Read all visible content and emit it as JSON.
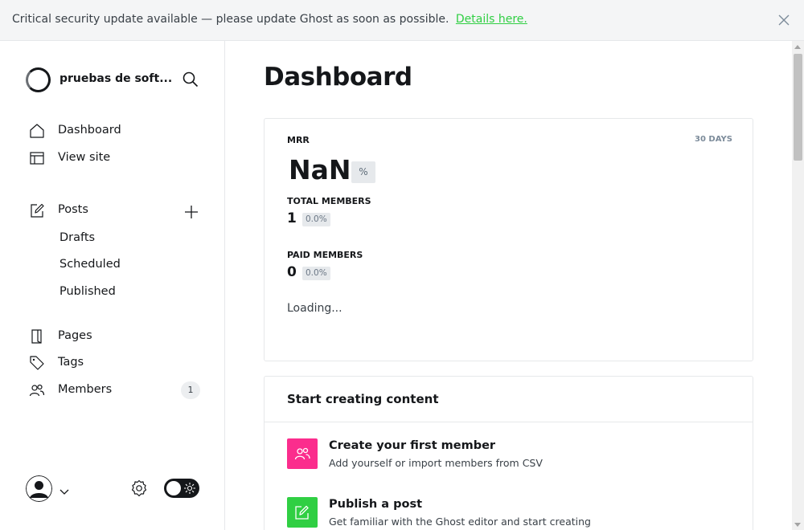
{
  "banner": {
    "message": "Critical security update available — please update Ghost as soon as possible.",
    "link_text": "Details here."
  },
  "sidebar": {
    "site_name": "pruebas de soft...",
    "nav": [
      {
        "label": "Dashboard",
        "icon": "house-icon"
      },
      {
        "label": "View site",
        "icon": "layout-icon"
      },
      {
        "label": "Posts",
        "icon": "pencil-square-icon"
      },
      {
        "label": "Pages",
        "icon": "page-icon"
      },
      {
        "label": "Tags",
        "icon": "tag-icon"
      },
      {
        "label": "Members",
        "icon": "members-icon",
        "count": "1"
      }
    ],
    "post_subitems": [
      "Drafts",
      "Scheduled",
      "Published"
    ]
  },
  "main": {
    "title": "Dashboard",
    "mrr": {
      "label": "MRR",
      "period": "30 DAYS",
      "value": "NaN",
      "unit": "%",
      "total_members_label": "TOTAL MEMBERS",
      "total_members_value": "1",
      "total_members_change": "0.0%",
      "paid_members_label": "PAID MEMBERS",
      "paid_members_value": "0",
      "paid_members_change": "0.0%",
      "loading": "Loading..."
    },
    "start": {
      "heading": "Start creating content",
      "steps": [
        {
          "title": "Create your first member",
          "description": "Add yourself or import members from CSV",
          "color": "#fb2d8d",
          "icon": "members-icon"
        },
        {
          "title": "Publish a post",
          "description": "Get familiar with the Ghost editor and start creating",
          "color": "#30cf43",
          "icon": "edit-icon"
        }
      ]
    }
  },
  "colors": {
    "accent_green": "#30cf43",
    "accent_pink": "#fb2d8d",
    "text_dark": "#15171a"
  }
}
